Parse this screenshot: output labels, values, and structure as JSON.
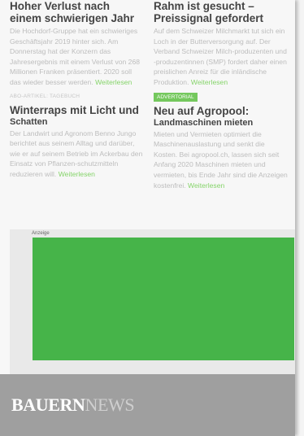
{
  "articles": [
    {
      "title": "Hoher Verlust nach einem schwierigen Jahr",
      "body": "Die Hochdorf-Gruppe hat ein schwieriges Geschäftsjahr 2019 hinter sich. Am Donnerstag hat der Konzern das Jahresergebnis mit einem Verlust von 268 Millionen Franken präsentiert. 2020 soll das wieder besser werden.",
      "more": "Weiterlesen"
    },
    {
      "title": "Rahm ist gesucht – Preissignal gefordert",
      "body": "Auf dem Schweizer Milchmarkt tut sich ein Loch in der Butterversorgung auf. Der Verband Schweizer Milch-produzenten und -produzentinnen (SMP) fordert daher einen preislichen Anreiz für die inländische Produktion.",
      "more": "Weiterlesen"
    },
    {
      "kicker": "ABO-ARTIKEL: TAGEBUCH",
      "title": "Winterraps mit Licht und",
      "subtitle": "Schatten",
      "body": "Der Landwirt und Agronom Benno Jungo berichtet aus seinem Alltag und darüber, wie er auf seinem Betrieb im Ackerbau den Einsatz von Pflanzen-schutzmitteln reduzieren will.",
      "more": "Weiterlesen"
    },
    {
      "badge": "ADVERTORIAL",
      "title": "Neu auf Agropool:",
      "subtitle": "Landmaschinen mieten",
      "body": "Mieten und Vermieten optimiert die Maschinenauslastung und senkt die Kosten. Bei agropool.ch, lassen sich seit Anfang 2020 Maschinen mieten und vermieten, bis Ende Jahr sind die Anzeigen kostenfrei.",
      "more": "Weiterlesen"
    }
  ],
  "ad": {
    "label": "Anzeige",
    "color": "#46b449"
  },
  "footer": {
    "logo_part1": "BAUERN",
    "logo_part2": "NEWS"
  }
}
